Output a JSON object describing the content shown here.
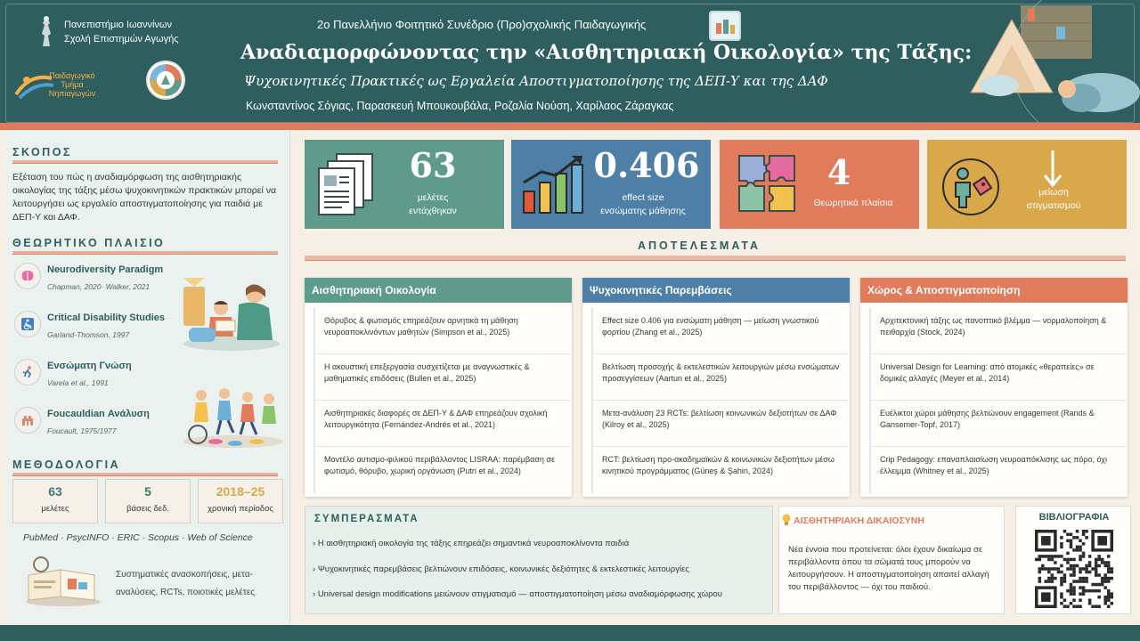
{
  "header": {
    "university": "Πανεπιστήμιο Ιωαννίνων",
    "school": "Σχολή Επιστημών Αγωγής",
    "department_logo_text": [
      "Παιδαγωγικό",
      "Τμήμα",
      "Νηπιαγωγών"
    ],
    "conference": "2ο Πανελλήνιο Φοιτητικό Συνέδριο (Προ)σχολικής Παιδαγωγικής",
    "title": "Αναδιαμορφώνοντας την «Αισθητηριακή Οικολογία» της Τάξης:",
    "subtitle": "Ψυχοκινητικές Πρακτικές ως Εργαλεία Αποστιγματοποίησης της ΔΕΠ-Υ και της ΔΑΦ",
    "authors": "Κωνσταντίνος Σόγιας, Παρασκευή Μπουκουβάλα, Ροζαλία Νούση, Χαρίλαος Ζάραγκας"
  },
  "sidebar": {
    "aim_heading": "ΣΚΟΠΟΣ",
    "aim_text": "Εξέταση του πώς η αναδιαμόρφωση της αισθητηριακής οικολογίας της τάξης μέσω ψυχοκινητικών πρακτικών μπορεί να λειτουργήσει ως εργαλείο αποστιγματοποίησης για παιδιά με ΔΕΠ-Υ και ΔΑΦ.",
    "framework_heading": "ΘΕΩΡΗΤΙΚΟ ΠΛΑΙΣΙΟ",
    "framework": [
      {
        "title": "Neurodiversity Paradigm",
        "cite": "Chapman, 2020· Walker, 2021",
        "icon": "brain-icon"
      },
      {
        "title": "Critical Disability Studies",
        "cite": "Garland-Thomson, 1997",
        "icon": "accessibility-icon"
      },
      {
        "title": "Ενσώματη Γνώση",
        "cite": "Varela et al., 1991",
        "icon": "movement-icon"
      },
      {
        "title": "Foucauldian Ανάλυση",
        "cite": "Foucault, 1975/1977",
        "icon": "building-icon"
      }
    ],
    "method_heading": "ΜΕΘΟΔΟΛΟΓΙΑ",
    "method_stats": [
      {
        "value": "63",
        "label": "μελέτες"
      },
      {
        "value": "5",
        "label": "βάσεις δεδ."
      },
      {
        "value": "2018–25",
        "label": "χρονική περίοδος"
      }
    ],
    "databases": "PubMed · PsycINFO · ERIC · Scopus · Web of Science",
    "study_types": "Συστηματικές ανασκοπήσεις, μετα-αναλύσεις, RCTs, ποιοτικές μελέτες"
  },
  "stats": [
    {
      "value": "63",
      "label_1": "μελέτες",
      "label_2": "εντάχθηκαν",
      "color": "#5f9b8a"
    },
    {
      "value": "0.406",
      "label_1": "effect size",
      "label_2": "ενσώματης μάθησης",
      "color": "#4e7fa7"
    },
    {
      "value": "4",
      "label_1": "Θεωρητικά πλαίσια",
      "label_2": "",
      "color": "#e07b5c"
    },
    {
      "value": "",
      "label_1": "μείωση",
      "label_2": "στιγματισμού",
      "color": "#d9a84a"
    }
  ],
  "results": {
    "heading": "ΑΠΟΤΕΛΕΣΜΑΤΑ",
    "columns": [
      {
        "title": "Αισθητηριακή Οικολογία",
        "color": "#5f9b8a",
        "items": [
          "Θόρυβος & φωτισμός επηρεάζουν αρνητικά τη μάθηση νευροαποκλινόντων μαθητών (Simpson et al., 2025)",
          "Η ακουστική επεξεργασία συσχετίζεται με αναγνωστικές & μαθηματικές επιδόσεις (Bullen et al., 2025)",
          "Αισθητηριακές διαφορές σε ΔΕΠ-Υ & ΔΑΦ επηρεάζουν σχολική λειτουργικότητα (Fernández-Andrés et al., 2021)",
          "Μοντέλο αυτισμο-φιλικού περιβάλλοντος LISRAA: παρέμβαση σε φωτισμό, θόρυβο, χωρική οργάνωση (Putri et al., 2024)"
        ]
      },
      {
        "title": "Ψυχοκινητικές Παρεμβάσεις",
        "color": "#4e7fa7",
        "items": [
          "Effect size 0.406 για ενσώματη μάθηση — μείωση γνωστικού φορτίου (Zhang et al., 2025)",
          "Βελτίωση προσοχής & εκτελεστικών λειτουργιών μέσω ενσώματων προσεγγίσεων (Aartun et al., 2025)",
          "Μετα-ανάλυση 23 RCTs: βελτίωση κοινωνικών δεξιοτήτων σε ΔΑΦ (Kilroy et al., 2025)",
          "RCT: βελτίωση προ-ακαδημαϊκών & κοινωνικών δεξιοτήτων μέσω κινητικού προγράμματος (Güneş & Şahin, 2024)"
        ]
      },
      {
        "title": "Χώρος & Αποστιγματοποίηση",
        "color": "#e07b5c",
        "items": [
          "Αρχιτεκτονική τάξης ως πανοπτικό βλέμμα — νορμαλοποίηση & πειθαρχία (Stock, 2024)",
          "Universal Design for Learning: από ατομικές «θεραπείες» σε δομικές αλλαγές (Meyer et al., 2014)",
          "Ευέλικτοι χώροι μάθησης βελτιώνουν engagement (Rands & Gansemer-Topf, 2017)",
          "Crip Pedagogy: επαναπλαισίωση νευροαπόκλισης ως πόρο, όχι έλλειμμα (Whitney et al., 2025)"
        ]
      }
    ]
  },
  "conclusions": {
    "heading": "ΣΥΜΠΕΡΑΣΜΑΤΑ",
    "items": [
      "Η αισθητηριακή οικολογία της τάξης επηρεάζει σημαντικά νευροαποκλίνοντα παιδιά",
      "Ψυχοκινητικές παρεμβάσεις βελτιώνουν επιδόσεις, κοινωνικές δεξιότητες & εκτελεστικές λειτουργίες",
      "Universal design modifications μειώνουν στιγματισμό — αποστιγματοποίηση μέσω αναδιαμόρφωσης χώρου"
    ]
  },
  "justice": {
    "heading": "ΑΙΣΘΗΤΗΡΙΑΚΗ ΔΙΚΑΙΟΣΥΝΗ",
    "text": "Νέα έννοια που προτείνεται: όλοι έχουν δικαίωμα σε περιβάλλοντα όπου τα σώματά τους μπορούν να λειτουργήσουν. Η αποστιγματοποίηση απαιτεί αλλαγή του περιβάλλοντος — όχι του παιδιού."
  },
  "bibliography": {
    "heading": "ΒΙΒΛΙΟΓΡΑΦΙΑ"
  },
  "colors": {
    "header": "#2e5e5e",
    "accent": "#e07b5c",
    "teal": "#5f9b8a",
    "blue": "#4e7fa7",
    "gold": "#d9a84a"
  }
}
